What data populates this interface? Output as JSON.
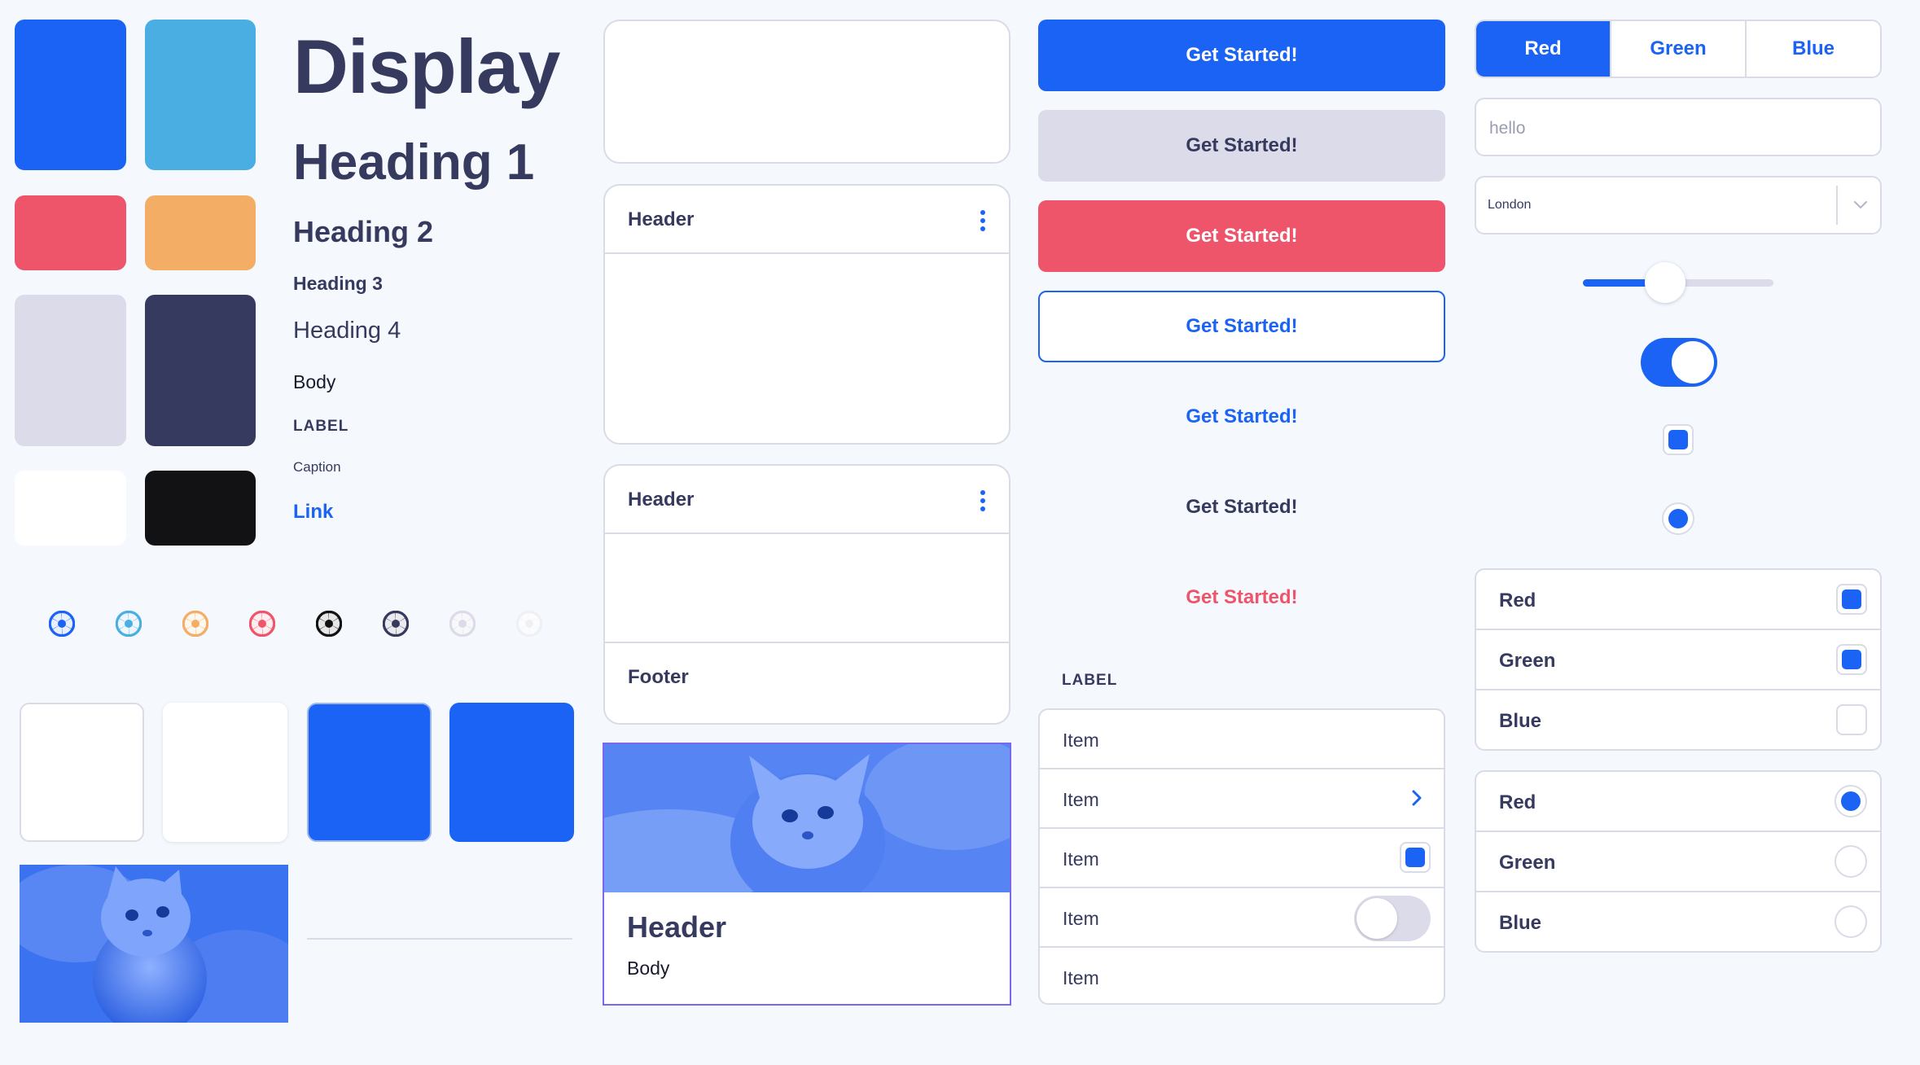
{
  "colors": {
    "primary": "#1b63f5",
    "sky": "#4aaee3",
    "coral": "#ee556b",
    "orange": "#f4ad64",
    "lavender": "#dcdbe9",
    "navy": "#363a5e",
    "white": "#ffffff",
    "black": "#121214"
  },
  "swatches": [
    "primary",
    "sky",
    "coral",
    "orange",
    "lavender",
    "navy",
    "white",
    "black"
  ],
  "aperture_icons": [
    "#1b63f5",
    "#4aaee3",
    "#f4ad64",
    "#ee556b",
    "#121214",
    "#363a5e",
    "#dcdbe9",
    "#ffffff"
  ],
  "typography": {
    "display": "Display",
    "heading1": "Heading 1",
    "heading2": "Heading 2",
    "heading3": "Heading 3",
    "heading4": "Heading 4",
    "body": "Body",
    "label": "LABEL",
    "caption": "Caption",
    "link": "Link"
  },
  "cards": {
    "card1": {
      "header": "Header"
    },
    "card2": {
      "header": "Header",
      "footer": "Footer"
    },
    "media_card": {
      "header": "Header",
      "body": "Body"
    }
  },
  "buttons": [
    {
      "label": "Get Started!",
      "style": "primary"
    },
    {
      "label": "Get Started!",
      "style": "secondary"
    },
    {
      "label": "Get Started!",
      "style": "danger"
    },
    {
      "label": "Get Started!",
      "style": "outline"
    },
    {
      "label": "Get Started!",
      "style": "text-primary"
    },
    {
      "label": "Get Started!",
      "style": "text-dark"
    },
    {
      "label": "Get Started!",
      "style": "text-danger"
    }
  ],
  "list": {
    "label": "LABEL",
    "items": [
      {
        "label": "Item",
        "accessory": "none"
      },
      {
        "label": "Item",
        "accessory": "chevron"
      },
      {
        "label": "Item",
        "accessory": "checkbox"
      },
      {
        "label": "Item",
        "accessory": "toggle"
      },
      {
        "label": "Item",
        "accessory": "none"
      }
    ]
  },
  "segmented": {
    "options": [
      "Red",
      "Green",
      "Blue"
    ],
    "selected": "Red"
  },
  "text_input": {
    "value": "hello"
  },
  "select": {
    "value": "London"
  },
  "slider": {
    "value": 0.43
  },
  "toggle": {
    "on": true
  },
  "checkbox_group": {
    "options": [
      {
        "label": "Red",
        "checked": true
      },
      {
        "label": "Green",
        "checked": true
      },
      {
        "label": "Blue",
        "checked": false
      }
    ]
  },
  "radio_group": {
    "options": [
      {
        "label": "Red",
        "selected": true
      },
      {
        "label": "Green",
        "selected": false
      },
      {
        "label": "Blue",
        "selected": false
      }
    ]
  }
}
